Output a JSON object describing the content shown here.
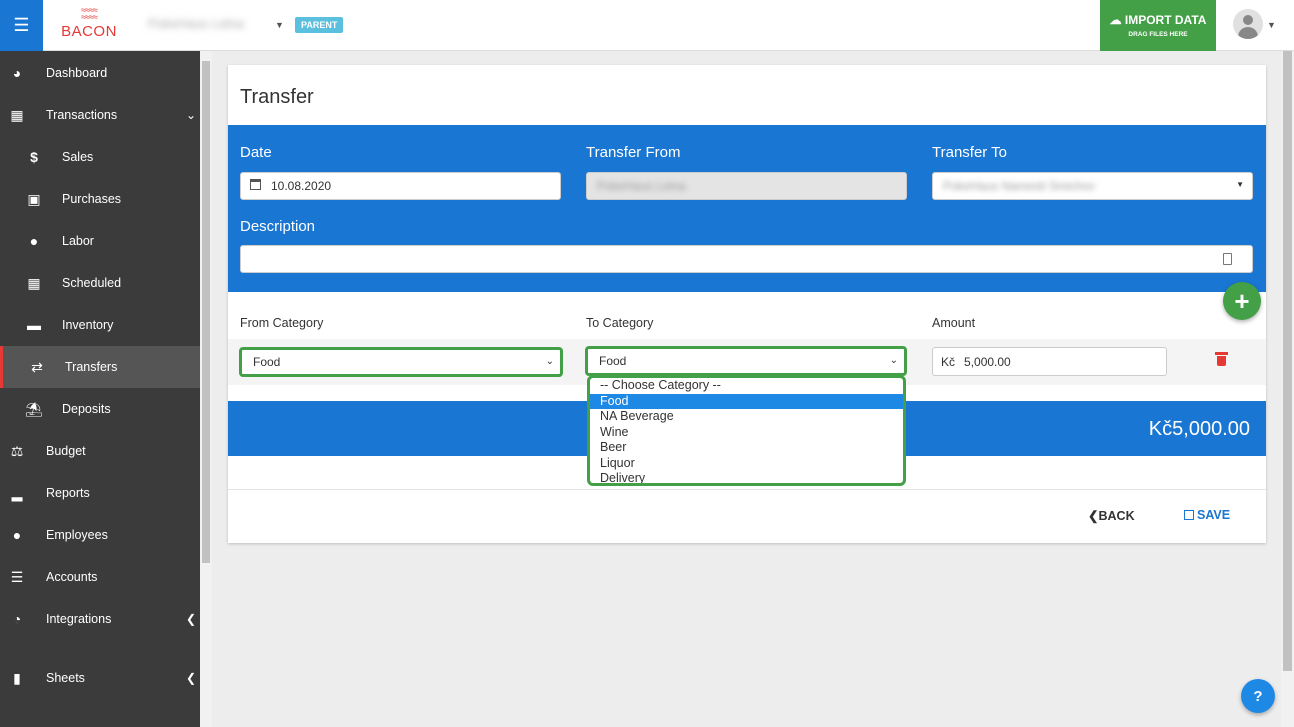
{
  "header": {
    "menu_icon": "hamburger-icon",
    "logo_text": "BACON",
    "org_name": "PokeHaus Letna",
    "parent_badge": "PARENT",
    "import_label": "IMPORT DATA",
    "import_sublabel": "DRAG FILES HERE",
    "avatar_icon": "user-icon"
  },
  "sidebar": {
    "items": [
      {
        "label": "Dashboard",
        "icon": "dashboard-icon"
      },
      {
        "label": "Transactions",
        "icon": "calendar-icon"
      },
      {
        "label": "Sales",
        "icon": "dollar-icon"
      },
      {
        "label": "Purchases",
        "icon": "shopping-bag-icon"
      },
      {
        "label": "Labor",
        "icon": "users-icon"
      },
      {
        "label": "Scheduled",
        "icon": "calendar-icon"
      },
      {
        "label": "Inventory",
        "icon": "truck-icon"
      },
      {
        "label": "Transfers",
        "icon": "exchange-icon"
      },
      {
        "label": "Deposits",
        "icon": "bank-icon"
      },
      {
        "label": "Budget",
        "icon": "balance-scale-icon"
      },
      {
        "label": "Reports",
        "icon": "bar-chart-icon"
      },
      {
        "label": "Employees",
        "icon": "users-icon"
      },
      {
        "label": "Accounts",
        "icon": "server-icon"
      },
      {
        "label": "Integrations",
        "icon": "pie-chart-icon"
      },
      {
        "label": "Sheets",
        "icon": "file-icon"
      }
    ],
    "active": "Transfers"
  },
  "form": {
    "title": "Transfer",
    "date_label": "Date",
    "date_value": "10.08.2020",
    "from_label": "Transfer From",
    "from_value": "PokeHaus Letna",
    "to_label": "Transfer To",
    "to_value": "PokeHaus Namesti Smichov",
    "description_label": "Description",
    "description_value": ""
  },
  "lines": {
    "from_category_label": "From Category",
    "to_category_label": "To Category",
    "amount_label": "Amount",
    "from_category_value": "Food",
    "to_category_value": "Food",
    "currency": "Kč",
    "amount_value": "5,000.00",
    "total": "Kč5,000.00"
  },
  "dropdown": {
    "options": [
      "-- Choose Category --",
      "Food",
      "NA Beverage",
      "Wine",
      "Beer",
      "Liquor",
      "Delivery"
    ],
    "selected": "Food"
  },
  "actions": {
    "back_label": "BACK",
    "save_label": "SAVE",
    "help_label": "?"
  }
}
